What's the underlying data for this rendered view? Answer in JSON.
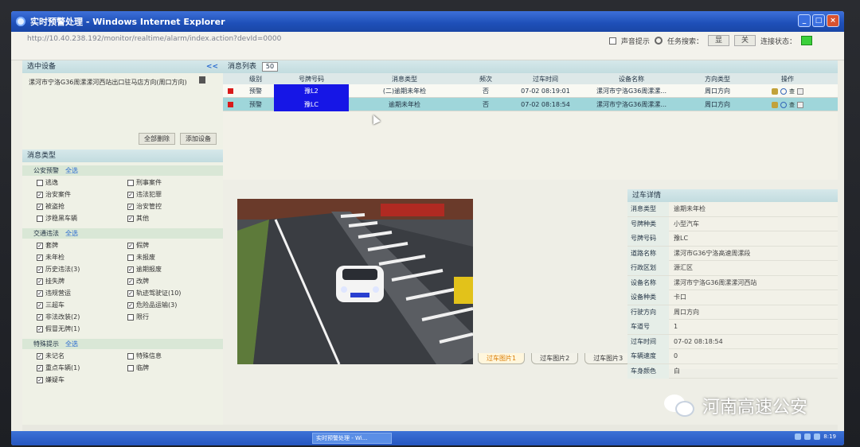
{
  "window": {
    "title": "实时预警处理 - Windows Internet Explorer",
    "address": "http://10.40.238.192/monitor/realtime/alarm/index.action?devId=0000"
  },
  "toolbar": {
    "sound_label": "声音提示",
    "task_label": "任务搜索：",
    "btn1": "显",
    "btn2": "关",
    "link_status_label": "连接状态：",
    "status_color": "#3bd03b"
  },
  "left": {
    "selected_header": "选中设备",
    "collapse": "<<",
    "selected_device": "漯河市宁洛G36周漯漯河西站出口驻马店方向(周口方向)",
    "btn_delete_all": "全部删除",
    "btn_add": "添加设备",
    "msg_type_header": "消息类型",
    "all_label": "全选",
    "groups": [
      {
        "title": "公安预警",
        "items": [
          {
            "label": "逃逸",
            "checked": false
          },
          {
            "label": "刑事案件",
            "checked": false
          },
          {
            "label": "治安案件",
            "checked": true
          },
          {
            "label": "违法犯罪",
            "checked": true
          },
          {
            "label": "被盗抢",
            "checked": true
          },
          {
            "label": "治安管控",
            "checked": true
          },
          {
            "label": "涉稳黑车辆",
            "checked": false
          },
          {
            "label": "其他",
            "checked": true
          }
        ]
      },
      {
        "title": "交通违法",
        "items": [
          {
            "label": "套牌",
            "checked": true
          },
          {
            "label": "假牌",
            "checked": true
          },
          {
            "label": "未年检",
            "checked": true
          },
          {
            "label": "未报废",
            "checked": false
          },
          {
            "label": "历史违法(3)",
            "checked": true
          },
          {
            "label": "逾期报废",
            "checked": true
          },
          {
            "label": "挂失牌",
            "checked": true
          },
          {
            "label": "改牌",
            "checked": true
          },
          {
            "label": "违规营运",
            "checked": true
          },
          {
            "label": "轨迹驾驶证(10)",
            "checked": true
          },
          {
            "label": "三超车",
            "checked": true
          },
          {
            "label": "危险品运输(3)",
            "checked": true
          },
          {
            "label": "非法改装(2)",
            "checked": true
          },
          {
            "label": "限行",
            "checked": false
          },
          {
            "label": "假冒无牌(1)",
            "checked": true
          }
        ]
      },
      {
        "title": "特殊提示",
        "items": [
          {
            "label": "未记名",
            "checked": true
          },
          {
            "label": "特殊信息",
            "checked": false
          },
          {
            "label": "重点车辆(1)",
            "checked": true
          },
          {
            "label": "临牌",
            "checked": false
          },
          {
            "label": "嫌疑车",
            "checked": true
          }
        ]
      }
    ]
  },
  "list": {
    "header": "消息列表",
    "page_size": "50",
    "columns": [
      "",
      "级别",
      "号牌号码",
      "消息类型",
      "频次",
      "过车时间",
      "设备名称",
      "方向类型",
      "操作"
    ],
    "rows": [
      {
        "level": "预警",
        "plate": "豫L2",
        "type": "(二)逾期未年检",
        "freq": "否",
        "time": "07-02 08:19:01",
        "device": "漯河市宁洛G36周漯漯...",
        "direction": "周口方向",
        "op": "查"
      },
      {
        "level": "预警",
        "plate": "豫LC",
        "type": "逾期未年检",
        "freq": "否",
        "time": "07-02 08:18:54",
        "device": "漯河市宁洛G36周漯漯...",
        "direction": "周口方向",
        "op": "查"
      }
    ],
    "plate_color": "#1616e6",
    "highlight_color": "#9fd6da"
  },
  "photo_tabs": [
    "过车图片1",
    "过车图片2",
    "过车图片3"
  ],
  "detail": {
    "header": "过车详情",
    "fields": [
      {
        "k": "消息类型",
        "v": "逾期未年检"
      },
      {
        "k": "号牌种类",
        "v": "小型汽车"
      },
      {
        "k": "号牌号码",
        "v": "豫LC"
      },
      {
        "k": "道路名称",
        "v": "漯河市G36宁洛高速周漯段"
      },
      {
        "k": "行政区划",
        "v": "源汇区"
      },
      {
        "k": "设备名称",
        "v": "漯河市宁洛G36周漯漯河西站"
      },
      {
        "k": "设备种类",
        "v": "卡口"
      },
      {
        "k": "行驶方向",
        "v": "周口方向"
      },
      {
        "k": "车道号",
        "v": "1"
      },
      {
        "k": "过车时间",
        "v": "07-02 08:18:54"
      },
      {
        "k": "车辆速度",
        "v": "0"
      },
      {
        "k": "车身颜色",
        "v": "白"
      }
    ]
  },
  "taskbar": {
    "item": "实时预警处理 - Wi...",
    "clock": "8:19"
  },
  "watermark": "河南高速公安"
}
